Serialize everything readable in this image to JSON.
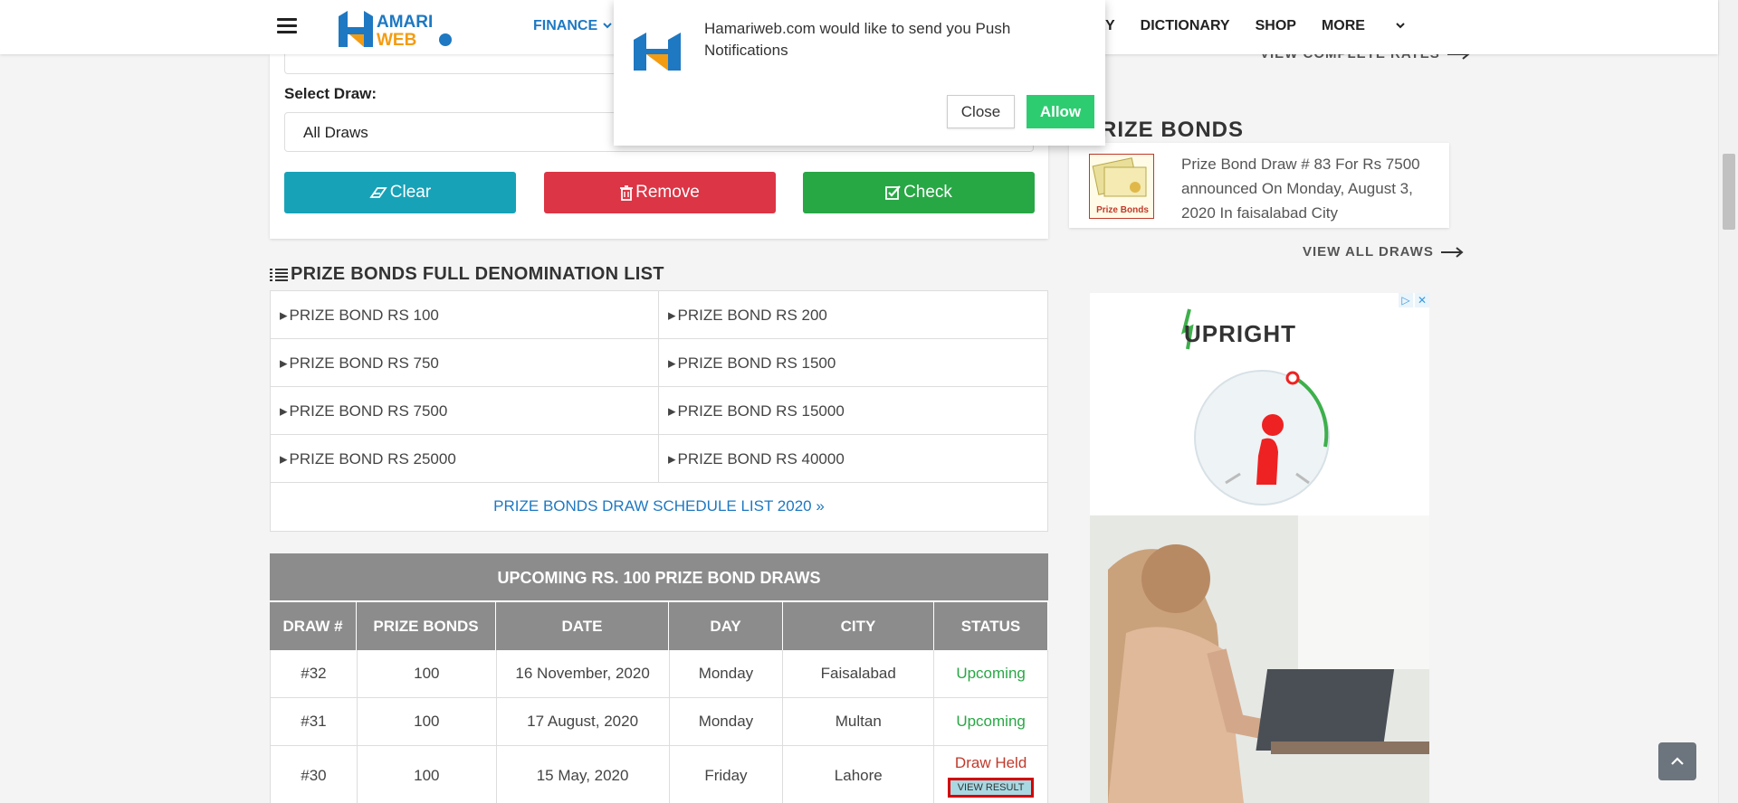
{
  "header": {
    "nav_finance": "FINANCE",
    "nav_items": [
      "RY",
      "DICTIONARY",
      "SHOP",
      "MORE"
    ]
  },
  "form": {
    "select_label": "Select Draw:",
    "select_value": "All Draws",
    "clear_label": "Clear",
    "remove_label": "Remove",
    "check_label": "Check"
  },
  "denomination": {
    "title": "PRIZE BONDS FULL DENOMINATION LIST",
    "items": [
      [
        "PRIZE BOND RS 100",
        "PRIZE BOND RS 200"
      ],
      [
        "PRIZE BOND RS 750",
        "PRIZE BOND RS 1500"
      ],
      [
        "PRIZE BOND RS 7500",
        "PRIZE BOND RS 15000"
      ],
      [
        "PRIZE BOND RS 25000",
        "PRIZE BOND RS 40000"
      ]
    ],
    "schedule_link": "PRIZE BONDS DRAW SCHEDULE LIST 2020"
  },
  "draws": {
    "title": "UPCOMING RS. 100 PRIZE BOND DRAWS",
    "columns": [
      "DRAW #",
      "PRIZE BONDS",
      "DATE",
      "DAY",
      "CITY",
      "STATUS"
    ],
    "rows": [
      {
        "draw": "#32",
        "bond": "100",
        "date": "16 November, 2020",
        "day": "Monday",
        "city": "Faisalabad",
        "status": "Upcoming"
      },
      {
        "draw": "#31",
        "bond": "100",
        "date": "17 August, 2020",
        "day": "Monday",
        "city": "Multan",
        "status": "Upcoming"
      },
      {
        "draw": "#30",
        "bond": "100",
        "date": "15 May, 2020",
        "day": "Friday",
        "city": "Lahore",
        "status": "Draw Held",
        "action": "VIEW RESULT"
      }
    ]
  },
  "sidebar": {
    "rates_link": "VIEW COMPLETE RATES",
    "prize_title": "RIZE BONDS",
    "card_text": "Prize Bond Draw # 83 For Rs 7500 announced On Monday, August 3, 2020 In faisalabad City",
    "thumb_label": "Prize Bonds",
    "view_all": "VIEW ALL DRAWS"
  },
  "ad": {
    "brand": "UPRIGHT"
  },
  "push": {
    "message": "Hamariweb.com would like to send you Push Notifications",
    "close_label": "Close",
    "allow_label": "Allow"
  },
  "colors": {
    "accent_blue": "#1e78c2",
    "clear": "#17a2b8",
    "remove": "#dc3545",
    "check": "#28a745",
    "allow": "#2ecc71"
  }
}
